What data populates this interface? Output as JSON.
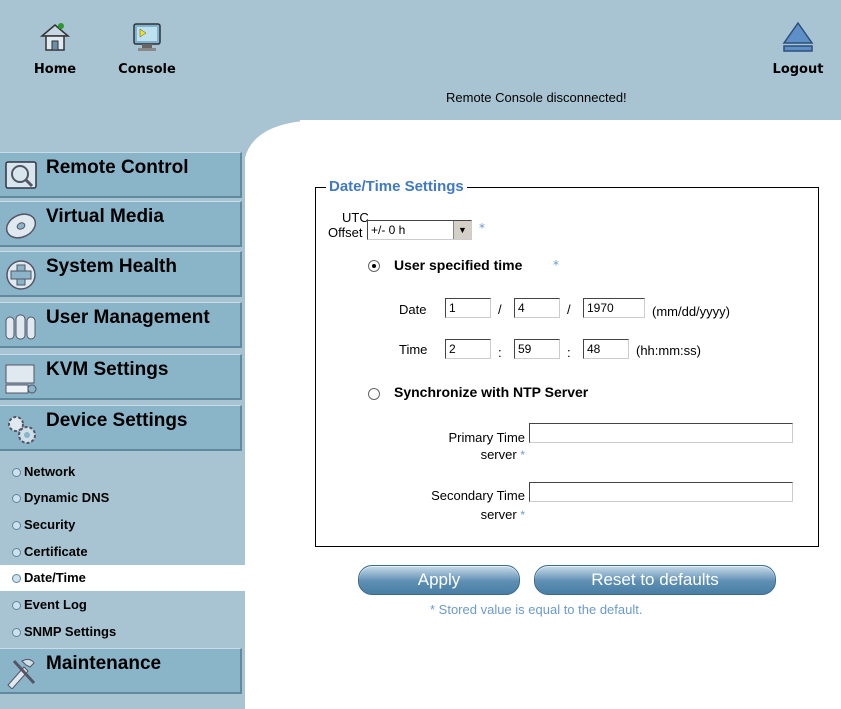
{
  "header": {
    "home_label": "Home",
    "console_label": "Console",
    "logout_label": "Logout",
    "status": "Remote Console disconnected!"
  },
  "sidebar": {
    "sections": [
      {
        "label": "Remote Control",
        "icon": "monitor-icon"
      },
      {
        "label": "Virtual Media",
        "icon": "disc-icon"
      },
      {
        "label": "System Health",
        "icon": "health-plus-icon"
      },
      {
        "label": "User Management",
        "icon": "users-icon"
      },
      {
        "label": "KVM Settings",
        "icon": "kvm-icon"
      },
      {
        "label": "Device Settings",
        "icon": "gears-icon"
      }
    ],
    "sub_items": [
      {
        "label": "Network"
      },
      {
        "label": "Dynamic DNS"
      },
      {
        "label": "Security"
      },
      {
        "label": "Certificate"
      },
      {
        "label": "Date/Time",
        "active": true
      },
      {
        "label": "Event Log"
      },
      {
        "label": "SNMP Settings"
      }
    ],
    "last_section": {
      "label": "Maintenance",
      "icon": "tools-icon"
    }
  },
  "form": {
    "legend": "Date/Time Settings",
    "utc_offset_label_line1": "UTC",
    "utc_offset_label_line2": "Offset",
    "utc_offset_value": "+/- 0 h",
    "star": "*",
    "user_time_label": "User specified time",
    "user_time_selected": true,
    "date_label": "Date",
    "date_month": "1",
    "date_day": "4",
    "date_year": "1970",
    "date_sep": "/",
    "date_format": "(mm/dd/yyyy)",
    "time_label": "Time",
    "time_hour": "2",
    "time_min": "59",
    "time_sec": "48",
    "time_sep": ":",
    "time_format": "(hh:mm:ss)",
    "ntp_label": "Synchronize with NTP Server",
    "primary_label_line1": "Primary Time",
    "primary_label_line2": "server",
    "primary_value": "",
    "secondary_label_line1": "Secondary Time",
    "secondary_label_line2": "server",
    "secondary_value": ""
  },
  "buttons": {
    "apply": "Apply",
    "reset": "Reset to defaults"
  },
  "note": "* Stored value is equal to the default.",
  "colors": {
    "header_bg": "#a8c4d2",
    "nav_button": "#8ab4c8",
    "legend_text": "#3f79c7",
    "star": "#6a9ad0"
  }
}
